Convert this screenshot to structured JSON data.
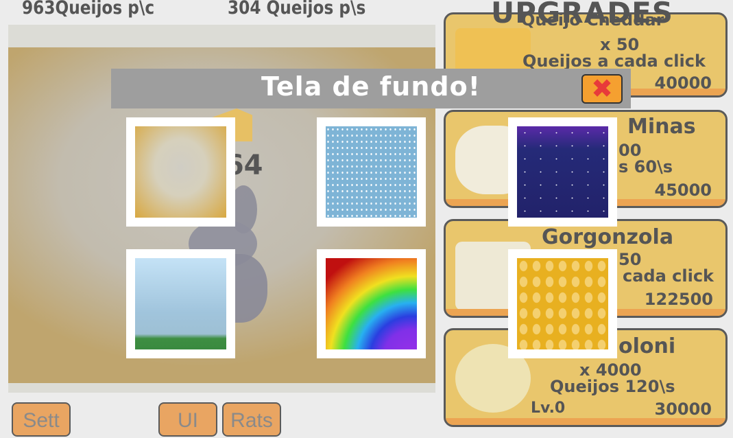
{
  "stats": {
    "per_click": "963Queijos p\\c",
    "per_second": "304 Queijos p\\s"
  },
  "counter": "964",
  "upgrades": {
    "title": "UPGRADES",
    "cards": [
      {
        "title": "Queijo Cheddar",
        "mult": "x 50",
        "desc": "Queijos a cada click",
        "price": "40000"
      },
      {
        "title": "Minas",
        "mult": "00",
        "desc": "s 60\\s",
        "price": "45000"
      },
      {
        "title": "Gorgonzola",
        "mult": "50",
        "desc": "cada click",
        "price": "122500"
      },
      {
        "title": "oloni",
        "mult": "x 4000",
        "desc": "Queijos 120\\s",
        "level": "Lv.0",
        "price": "30000"
      }
    ]
  },
  "buttons": {
    "settings": "Sett",
    "ui": "UI",
    "rats": "Rats"
  },
  "modal": {
    "title": "Tela de fundo!",
    "close_icon": "close-x-icon",
    "backgrounds": [
      "cheese-glow",
      "blue-snow",
      "night-sky",
      "sky-grass",
      "rainbow",
      "cheese-pattern"
    ]
  },
  "colors": {
    "card": "#e9c66c",
    "button": "#e9a562",
    "modal_header": "#9e9e9e",
    "close": "#f5a030"
  }
}
